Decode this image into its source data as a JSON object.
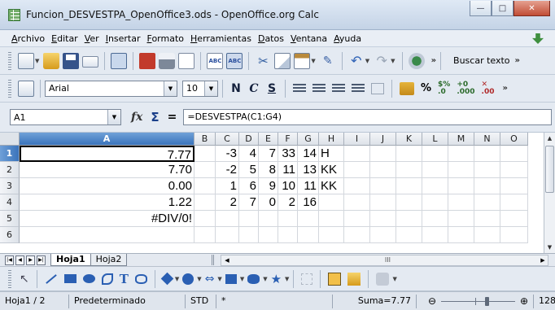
{
  "window": {
    "title": "Funcion_DESVESTPA_OpenOffice3.ods - OpenOffice.org Calc",
    "minimize_glyph": "—",
    "maximize_glyph": "□",
    "close_glyph": "✕"
  },
  "menu": [
    "Archivo",
    "Editar",
    "Ver",
    "Insertar",
    "Formato",
    "Herramientas",
    "Datos",
    "Ventana",
    "Ayuda"
  ],
  "standard_toolbar": {
    "search_label": "Buscar texto"
  },
  "format_toolbar": {
    "font_name": "Arial",
    "font_size": "10",
    "bold": "N",
    "italic": "C",
    "underline": "S",
    "percent": "%"
  },
  "formula_bar": {
    "name_box": "A1",
    "formula": "=DESVESTPA(C1:G4)"
  },
  "sheet": {
    "columns": [
      {
        "label": "A",
        "width": 215
      },
      {
        "label": "B",
        "width": 26
      },
      {
        "label": "C",
        "width": 29
      },
      {
        "label": "D",
        "width": 24
      },
      {
        "label": "E",
        "width": 24
      },
      {
        "label": "F",
        "width": 24
      },
      {
        "label": "G",
        "width": 26
      },
      {
        "label": "H",
        "width": 31
      },
      {
        "label": "I",
        "width": 32
      },
      {
        "label": "J",
        "width": 32
      },
      {
        "label": "K",
        "width": 32
      },
      {
        "label": "L",
        "width": 32
      },
      {
        "label": "M",
        "width": 32
      },
      {
        "label": "N",
        "width": 32
      },
      {
        "label": "O",
        "width": 34
      }
    ],
    "selected_column": "A",
    "selected_row": "1",
    "active_cell": "A1",
    "rows": [
      {
        "num": "1",
        "cells": {
          "A": "7.77",
          "C": "-3",
          "D": "4",
          "E": "7",
          "F": "33",
          "G": "14",
          "H": "H"
        }
      },
      {
        "num": "2",
        "cells": {
          "A": "7.70",
          "C": "-2",
          "D": "5",
          "E": "8",
          "F": "11",
          "G": "13",
          "H": "KK"
        }
      },
      {
        "num": "3",
        "cells": {
          "A": "0.00",
          "C": "1",
          "D": "6",
          "E": "9",
          "F": "10",
          "G": "11",
          "H": "KK"
        }
      },
      {
        "num": "4",
        "cells": {
          "A": "1.22",
          "C": "2",
          "D": "7",
          "E": "0",
          "F": "2",
          "G": "16"
        }
      },
      {
        "num": "5",
        "cells": {
          "A": "#DIV/0!"
        }
      },
      {
        "num": "6",
        "cells": {}
      }
    ],
    "text_columns": [
      "H"
    ]
  },
  "tabs": {
    "sheets": [
      "Hoja1",
      "Hoja2"
    ],
    "active": "Hoja1",
    "hscroll_grip": "III"
  },
  "status": {
    "page": "Hoja1 / 2",
    "style": "Predeterminado",
    "mode": "STD",
    "modified": "*",
    "sum": "Suma=7.77",
    "zoom": "128%",
    "zoom_level": 0.62
  }
}
